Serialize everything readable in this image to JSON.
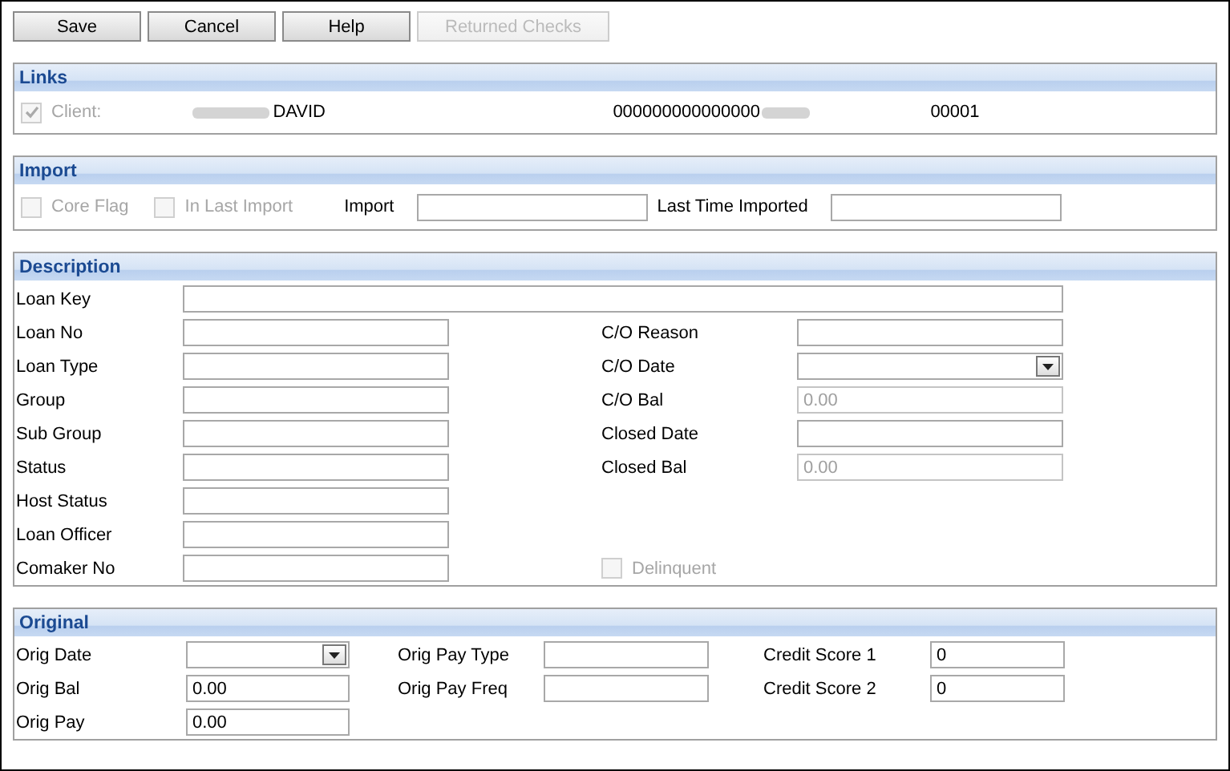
{
  "toolbar": {
    "buttons": [
      {
        "label": "Save",
        "disabled": false
      },
      {
        "label": "Cancel",
        "disabled": false
      },
      {
        "label": "Help",
        "disabled": false
      },
      {
        "label": "Returned Checks",
        "disabled": true
      }
    ]
  },
  "links": {
    "title": "Links",
    "client": {
      "label": "Client:",
      "checked": true,
      "disabled": true
    },
    "name": "DAVID",
    "account": "000000000000000",
    "suffix": "00001"
  },
  "import": {
    "title": "Import",
    "checkboxes": [
      {
        "label": "Core Flag",
        "checked": false,
        "disabled": true
      },
      {
        "label": "In Last Import",
        "checked": false,
        "disabled": true
      }
    ],
    "fields": [
      {
        "label": "Import"
      },
      {
        "label": "Last Time Imported"
      }
    ]
  },
  "description": {
    "title": "Description",
    "loan_key": {
      "label": "Loan Key"
    },
    "left_fields": [
      {
        "label": "Loan No",
        "kind": "text"
      },
      {
        "label": "Loan Type",
        "kind": "text"
      },
      {
        "label": "Group",
        "kind": "text"
      },
      {
        "label": "Sub Group",
        "kind": "text"
      },
      {
        "label": "Status",
        "kind": "text"
      },
      {
        "label": "Host Status",
        "kind": "text"
      },
      {
        "label": "Loan Officer",
        "kind": "text"
      },
      {
        "label": "Comaker No",
        "kind": "text"
      }
    ],
    "right_fields": [
      {
        "label": "C/O Reason",
        "kind": "text",
        "disabled": false
      },
      {
        "label": "C/O Date",
        "kind": "date",
        "disabled": false
      },
      {
        "label": "C/O Bal",
        "kind": "text",
        "value": "0.00",
        "disabled": true
      },
      {
        "label": "Closed Date",
        "kind": "text",
        "disabled": false
      },
      {
        "label": "Closed Bal",
        "kind": "text",
        "value": "0.00",
        "disabled": true
      }
    ],
    "delinquent": {
      "label": "Delinquent",
      "checked": false,
      "disabled": true
    }
  },
  "original": {
    "title": "Original",
    "columns": [
      [
        {
          "label": "Orig Date",
          "kind": "date"
        },
        {
          "label": "Orig Bal",
          "kind": "text",
          "value": "0.00"
        },
        {
          "label": "Orig Pay",
          "kind": "text",
          "value": "0.00"
        }
      ],
      [
        {
          "label": "Orig Pay Type",
          "kind": "text"
        },
        {
          "label": "Orig Pay Freq",
          "kind": "text"
        }
      ],
      [
        {
          "label": "Credit Score 1",
          "kind": "text",
          "value": "0"
        },
        {
          "label": "Credit Score 2",
          "kind": "text",
          "value": "0"
        }
      ]
    ]
  }
}
